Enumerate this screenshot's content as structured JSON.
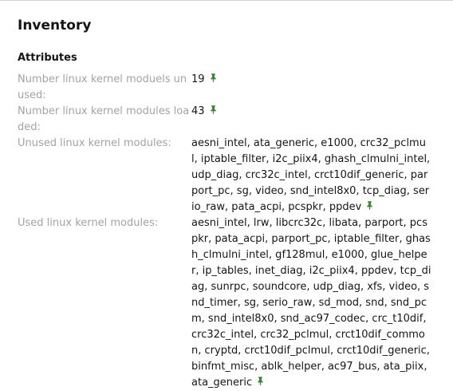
{
  "page": {
    "title": "Inventory",
    "section": "Attributes"
  },
  "colors": {
    "label": "#a3a3a3",
    "value": "#151515",
    "pin": "#3e8635"
  },
  "attributes": [
    {
      "label": "Number linux kernel moduels unused:",
      "value": "19",
      "icon": "pin-icon"
    },
    {
      "label": "Number linux kernel modules loaded:",
      "value": "43",
      "icon": "pin-icon"
    },
    {
      "label": "Unused linux kernel modules:",
      "value": "aesni_intel, ata_generic, e1000, crc32_pclmul, iptable_filter, i2c_piix4, ghash_clmulni_intel, udp_diag, crc32c_intel, crct10dif_generic, parport_pc, sg, video, snd_intel8x0, tcp_diag, serio_raw, pata_acpi, pcspkr, ppdev",
      "icon": "pin-icon"
    },
    {
      "label": "Used linux kernel modules:",
      "value": "aesni_intel, lrw, libcrc32c, libata, parport, pcspkr, pata_acpi, parport_pc, iptable_filter, ghash_clmulni_intel, gf128mul, e1000, glue_helper, ip_tables, inet_diag, i2c_piix4, ppdev, tcp_diag, sunrpc, soundcore, udp_diag, xfs, video, snd_timer, sg, serio_raw, sd_mod, snd, snd_pcm, snd_intel8x0, snd_ac97_codec, crc_t10dif, crc32c_intel, crc32_pclmul, crct10dif_common, cryptd, crct10dif_pclmul, crct10dif_generic, binfmt_misc, ablk_helper, ac97_bus, ata_piix, ata_generic",
      "icon": "pin-icon"
    }
  ]
}
